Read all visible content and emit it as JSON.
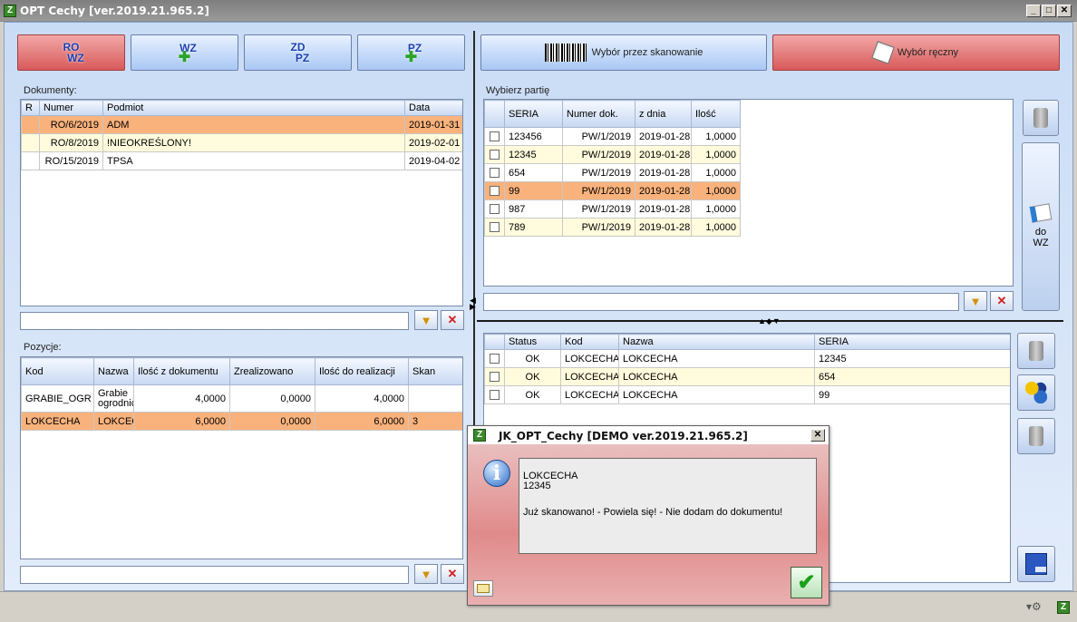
{
  "window": {
    "title": "OPT Cechy [ver.2019.21.965.2]",
    "minimize": "_",
    "maximize": "□",
    "close": "✕"
  },
  "toolbar": {
    "ro_top": "RO",
    "ro_bottom": "WZ",
    "wz": "WZ",
    "zd_top": "ZD",
    "zd_bottom": "PZ",
    "pz": "PZ",
    "plus": "✚",
    "scan_label": "Wybór przez skanowanie",
    "manual_label": "Wybór ręczny"
  },
  "documents": {
    "label": "Dokumenty:",
    "columns": [
      "R",
      "Numer",
      "Podmiot",
      "Data"
    ],
    "rows": [
      {
        "r": "",
        "numer": "RO/6/2019",
        "podmiot": "ADM",
        "data": "2019-01-31"
      },
      {
        "r": "",
        "numer": "RO/8/2019",
        "podmiot": "!NIEOKREŚLONY!",
        "data": "2019-02-01"
      },
      {
        "r": "",
        "numer": "RO/15/2019",
        "podmiot": "TPSA",
        "data": "2019-04-02"
      }
    ]
  },
  "positions": {
    "label": "Pozycje:",
    "columns": [
      "Kod",
      "Nazwa",
      "Ilość z dokumentu",
      "Zrealizowano",
      "Ilość do realizacji",
      "Skan"
    ],
    "rows": [
      {
        "kod": "GRABIE_OGR",
        "nazwa": "Grabie ogrodnic",
        "ilosc": "4,0000",
        "zreal": "0,0000",
        "do_real": "4,0000",
        "skan": ""
      },
      {
        "kod": "LOKCECHA",
        "nazwa": "LOKCEC",
        "ilosc": "6,0000",
        "zreal": "0,0000",
        "do_real": "6,0000",
        "skan": "3"
      }
    ]
  },
  "batch": {
    "label": "Wybierz partię",
    "columns": [
      "SERIA",
      "Numer dok.",
      "z dnia",
      "Ilość"
    ],
    "rows": [
      {
        "seria": "123456",
        "numer": "PW/1/2019",
        "data": "2019-01-28",
        "ilosc": "1,0000"
      },
      {
        "seria": "12345",
        "numer": "PW/1/2019",
        "data": "2019-01-28",
        "ilosc": "1,0000"
      },
      {
        "seria": "654",
        "numer": "PW/1/2019",
        "data": "2019-01-28",
        "ilosc": "1,0000"
      },
      {
        "seria": "99",
        "numer": "PW/1/2019",
        "data": "2019-01-28",
        "ilosc": "1,0000"
      },
      {
        "seria": "987",
        "numer": "PW/1/2019",
        "data": "2019-01-28",
        "ilosc": "1,0000"
      },
      {
        "seria": "789",
        "numer": "PW/1/2019",
        "data": "2019-01-28",
        "ilosc": "1,0000"
      }
    ]
  },
  "to_wz": {
    "line1": "do",
    "line2": "WZ"
  },
  "selected": {
    "columns": [
      "Status",
      "Kod",
      "Nazwa",
      "SERIA"
    ],
    "rows": [
      {
        "status": "OK",
        "kod": "LOKCECHA",
        "nazwa": "LOKCECHA",
        "seria": "12345"
      },
      {
        "status": "OK",
        "kod": "LOKCECHA",
        "nazwa": "LOKCECHA",
        "seria": "654"
      },
      {
        "status": "OK",
        "kod": "LOKCECHA",
        "nazwa": "LOKCECHA",
        "seria": "99"
      }
    ]
  },
  "dialog": {
    "title": "JK_OPT_Cechy [DEMO ver.2019.21.965.2]",
    "line1": "LOKCECHA",
    "line2": "12345",
    "line3": "Już skanowano! - Powiela się! - Nie dodam do dokumentu!",
    "close": "✕",
    "info": "i"
  },
  "icons": {
    "app": "app-logo-icon",
    "filter": "funnel-icon",
    "clear": "funnel-clear-icon"
  },
  "colors": {
    "selected_row": "#f9b27c",
    "alt_row": "#fffbdc",
    "red_button": "#d85a5a",
    "blue_button": "#a9c8f4"
  }
}
